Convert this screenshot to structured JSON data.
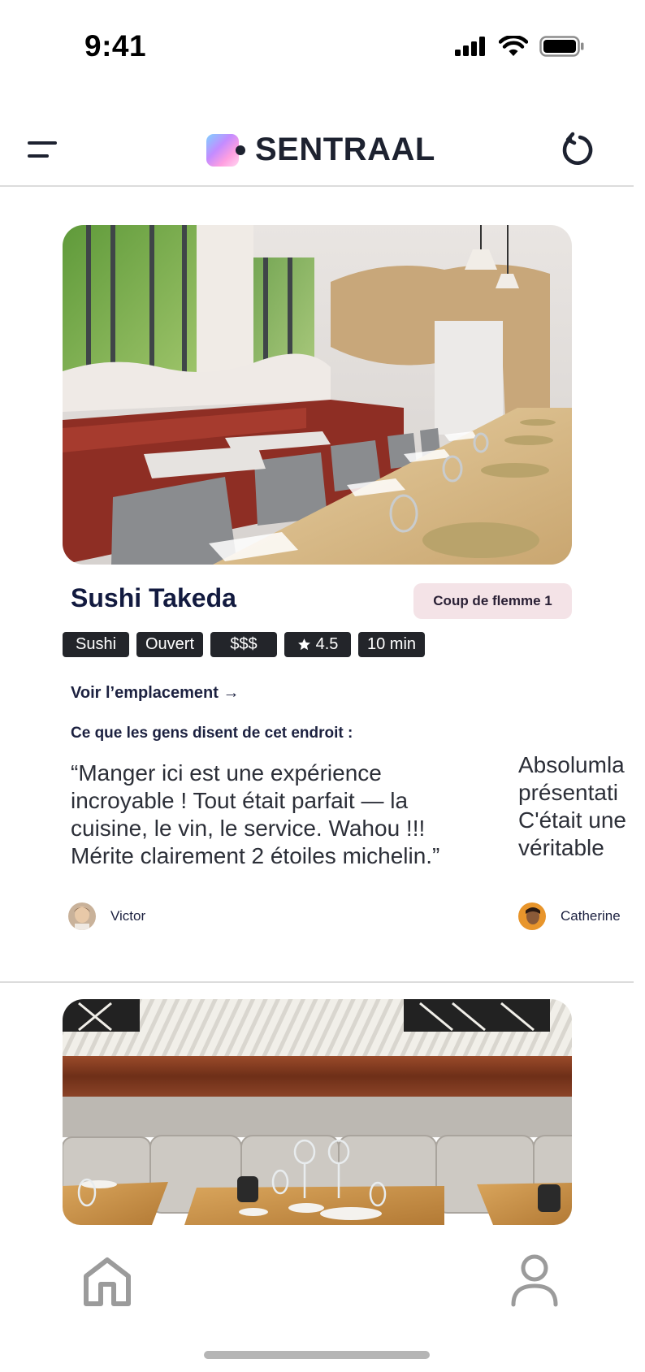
{
  "status_bar": {
    "time": "9:41",
    "icons": [
      "cellular-signal-icon",
      "wifi-icon",
      "battery-icon"
    ]
  },
  "header": {
    "app_name": "SENTRAAL",
    "left_icon": "menu-icon",
    "right_icon": "refresh-icon"
  },
  "restaurant": {
    "name": "Sushi Takeda",
    "badge": "Coup de flemme 1",
    "tags": [
      {
        "label": "Sushi"
      },
      {
        "label": "Ouvert"
      },
      {
        "label": "$$$"
      },
      {
        "label": "4.5",
        "icon": "star-icon"
      },
      {
        "label": "10 min"
      }
    ],
    "location_link": "Voir l’emplacement →",
    "reviews_heading": "Ce que les gens disent de cet endroit :",
    "reviews": [
      {
        "text": "“Manger ici est une expérience incroyable ! Tout était parfait — la cuisine, le vin, le service. Wahou !!! Mérite clairement 2 étoiles michelin.”",
        "author": "Victor"
      },
      {
        "text_lines": [
          "Absolumla",
          "présentati",
          "C'était une",
          "véritable"
        ],
        "author": "Catherine"
      }
    ]
  },
  "tabbar": {
    "items": [
      "home-icon",
      "profile-icon"
    ]
  },
  "colors": {
    "tag_bg": "#23252a",
    "badge_bg": "#f4e3e7",
    "title_text": "#121a3f"
  }
}
